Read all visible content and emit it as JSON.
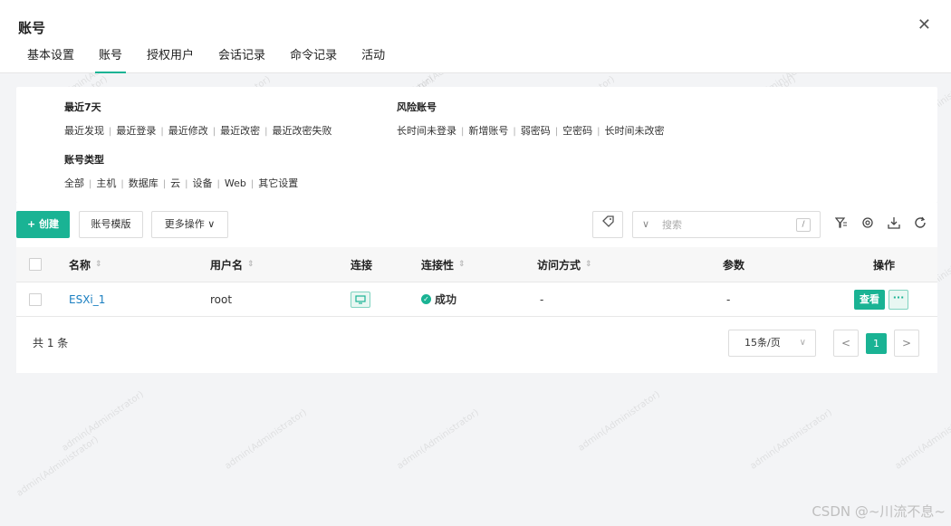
{
  "window": {
    "title": "账号",
    "close_glyph": "✕"
  },
  "tabs": [
    {
      "label": "基本设置"
    },
    {
      "label": "账号",
      "active": true
    },
    {
      "label": "授权用户"
    },
    {
      "label": "会话记录"
    },
    {
      "label": "命令记录"
    },
    {
      "label": "活动"
    }
  ],
  "filters": {
    "recent": {
      "title": "最近7天",
      "items": [
        "最近发现",
        "最近登录",
        "最近修改",
        "最近改密",
        "最近改密失败"
      ]
    },
    "risk": {
      "title": "风险账号",
      "items": [
        "长时间未登录",
        "新增账号",
        "弱密码",
        "空密码",
        "长时间未改密"
      ]
    },
    "type": {
      "title": "账号类型",
      "items": [
        "全部",
        "主机",
        "数据库",
        "云",
        "设备",
        "Web",
        "其它设置"
      ]
    },
    "separator": "|"
  },
  "toolbar": {
    "create_label": "+ 创建",
    "template_label": "账号模版",
    "more_label": "更多操作 ∨",
    "search_placeholder": "搜索",
    "search_shortcut": "/",
    "icons": [
      "tag-icon",
      "filter-columns-icon",
      "settings-icon",
      "download-icon",
      "refresh-icon"
    ]
  },
  "table": {
    "columns": {
      "name": "名称",
      "username": "用户名",
      "connect": "连接",
      "connectivity": "连接性",
      "access": "访问方式",
      "params": "参数",
      "actions": "操作"
    },
    "rows": [
      {
        "name": "ESXi_1",
        "username": "root",
        "connectivity": "成功",
        "access": "-",
        "params": "-",
        "view_label": "查看",
        "more_label": "···"
      }
    ]
  },
  "footer": {
    "total": "共 1 条",
    "page_size": "15条/页",
    "current_page": "1",
    "prev": "<",
    "next": ">"
  },
  "watermark_text": "admin(Administrator)",
  "credit": "CSDN @~川流不息~",
  "colors": {
    "accent": "#1ab394",
    "link": "#1a7fc1"
  }
}
